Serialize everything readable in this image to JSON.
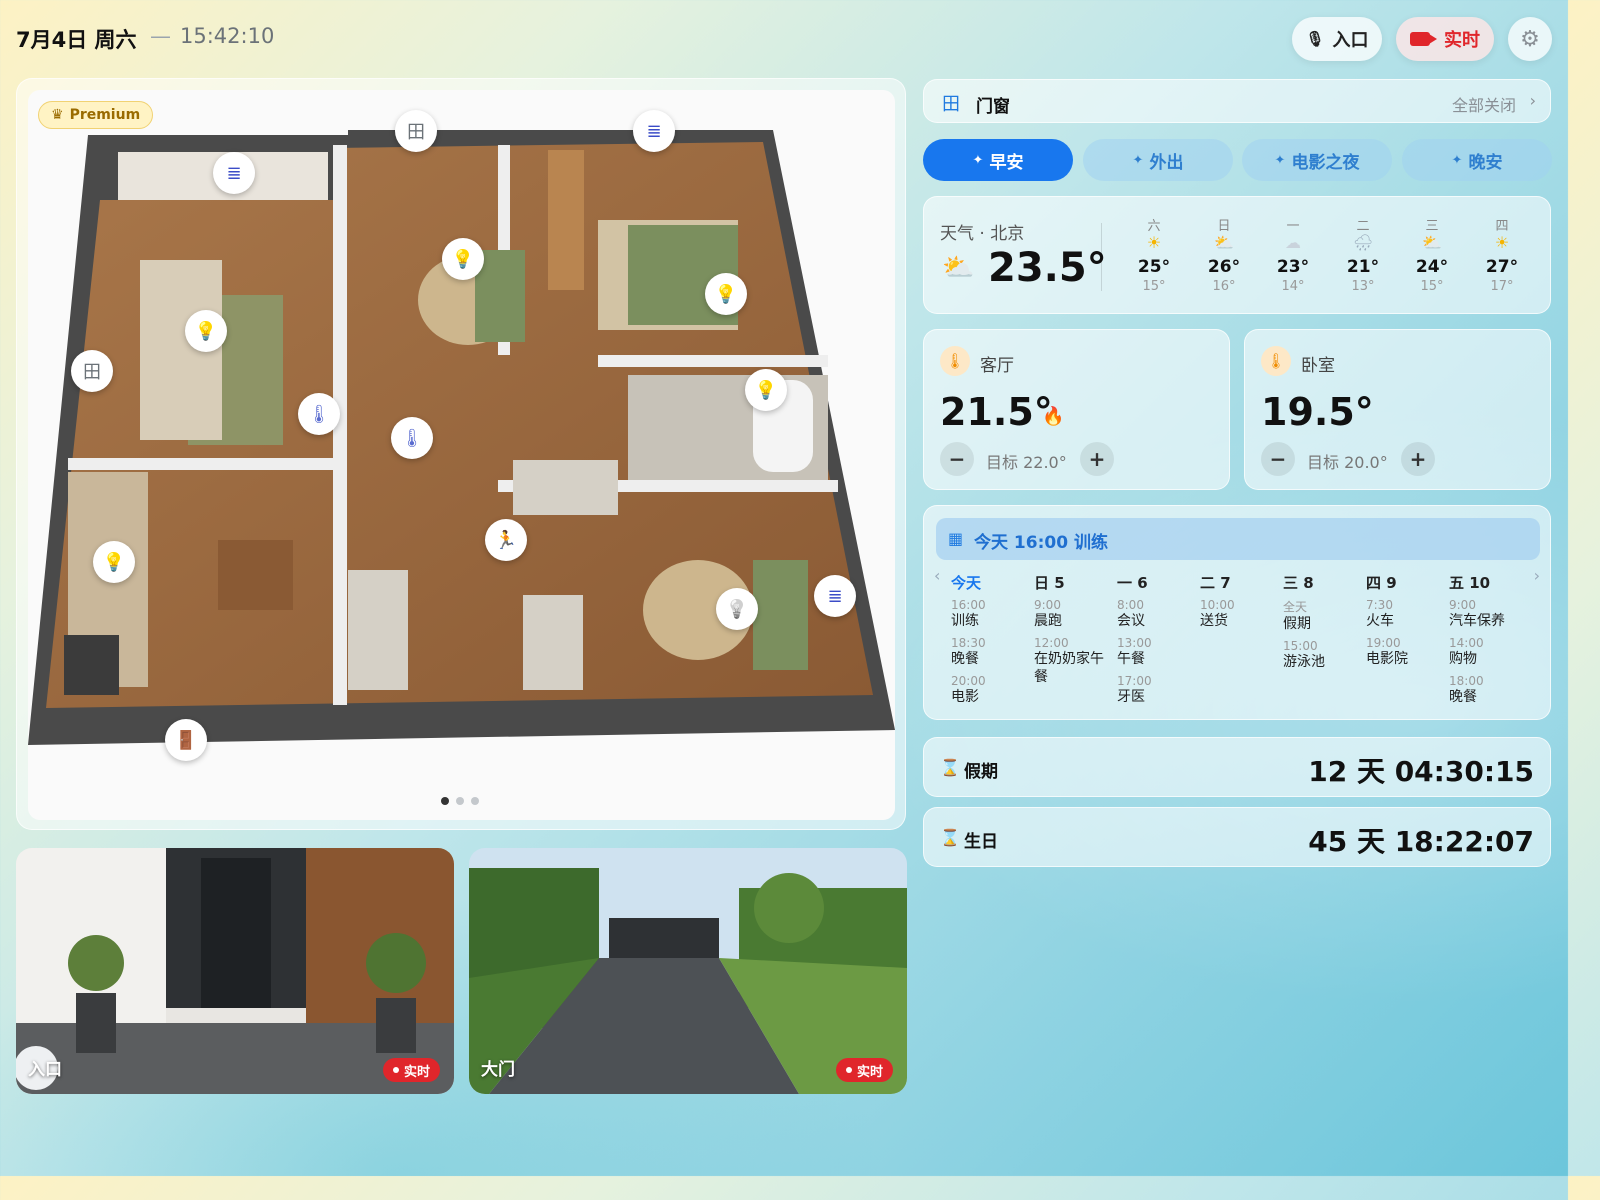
{
  "header": {
    "date": "7月4日 周六",
    "separator": "—",
    "time": "15:42:10",
    "entry_button": "入口",
    "live_button": "实时",
    "colors": {
      "live": "#e0262b"
    }
  },
  "floorplan": {
    "badge": "Premium",
    "markers": [
      {
        "icon": "window-icon",
        "glyph": "田"
      },
      {
        "icon": "blinds-icon",
        "glyph": "≣"
      },
      {
        "icon": "blinds-icon",
        "glyph": "≣"
      },
      {
        "icon": "light-bulb-icon",
        "glyph": "💡"
      },
      {
        "icon": "light-bulb-icon",
        "glyph": "💡"
      },
      {
        "icon": "light-bulb-icon",
        "glyph": "💡"
      },
      {
        "icon": "window-icon",
        "glyph": "田"
      },
      {
        "icon": "thermometer-icon",
        "glyph": "🌡"
      },
      {
        "icon": "thermometer-icon",
        "glyph": "🌡"
      },
      {
        "icon": "light-bulb-icon",
        "glyph": "💡"
      },
      {
        "icon": "motion-sensor-icon",
        "glyph": "🏃"
      },
      {
        "icon": "light-bulb-icon",
        "glyph": "💡"
      },
      {
        "icon": "light-bulb-off-icon",
        "glyph": "💡"
      },
      {
        "icon": "blinds-icon",
        "glyph": "≣"
      },
      {
        "icon": "door-icon",
        "glyph": "🚪"
      }
    ],
    "pages": 3,
    "active_page": 1
  },
  "cameras": [
    {
      "label": "入口",
      "live": "实时"
    },
    {
      "label": "大门",
      "live": "实时"
    }
  ],
  "doors": {
    "title": "门窗",
    "action": "全部关闭"
  },
  "scenes": [
    {
      "label": "早安",
      "active": true
    },
    {
      "label": "外出",
      "active": false
    },
    {
      "label": "电影之夜",
      "active": false
    },
    {
      "label": "晚安",
      "active": false
    }
  ],
  "weather": {
    "title": "天气 · 北京",
    "current": "23.5°",
    "forecast": [
      {
        "day": "六",
        "icon": "sun-icon",
        "glyph": "☀",
        "hi": "25°",
        "lo": "15°"
      },
      {
        "day": "日",
        "icon": "partly-cloudy-icon",
        "glyph": "⛅",
        "hi": "26°",
        "lo": "16°"
      },
      {
        "day": "一",
        "icon": "cloud-icon",
        "glyph": "☁",
        "hi": "23°",
        "lo": "14°"
      },
      {
        "day": "二",
        "icon": "rain-icon",
        "glyph": "🌧",
        "hi": "21°",
        "lo": "13°"
      },
      {
        "day": "三",
        "icon": "partly-cloudy-icon",
        "glyph": "⛅",
        "hi": "24°",
        "lo": "15°"
      },
      {
        "day": "四",
        "icon": "sun-icon",
        "glyph": "☀",
        "hi": "27°",
        "lo": "17°"
      }
    ]
  },
  "rooms": [
    {
      "name": "客厅",
      "temp": "21.5°",
      "target": "目标 22.0°",
      "heating": true
    },
    {
      "name": "卧室",
      "temp": "19.5°",
      "target": "目标 20.0°",
      "heating": false
    }
  ],
  "calendar": {
    "headline": "今天 16:00 训练",
    "days": [
      {
        "label": "今天",
        "today": true,
        "events": [
          {
            "time": "16:00",
            "title": "训练"
          },
          {
            "time": "18:30",
            "title": "晚餐"
          },
          {
            "time": "20:00",
            "title": "电影"
          }
        ]
      },
      {
        "label": "日 5",
        "today": false,
        "events": [
          {
            "time": "9:00",
            "title": "晨跑"
          },
          {
            "time": "12:00",
            "title": "在奶奶家午餐"
          }
        ]
      },
      {
        "label": "一 6",
        "today": false,
        "events": [
          {
            "time": "8:00",
            "title": "会议"
          },
          {
            "time": "13:00",
            "title": "午餐"
          },
          {
            "time": "17:00",
            "title": "牙医"
          }
        ]
      },
      {
        "label": "二 7",
        "today": false,
        "events": [
          {
            "time": "10:00",
            "title": "送货"
          }
        ]
      },
      {
        "label": "三 8",
        "today": false,
        "events": [
          {
            "time": "全天",
            "title": "假期"
          },
          {
            "time": "15:00",
            "title": "游泳池"
          }
        ]
      },
      {
        "label": "四 9",
        "today": false,
        "events": [
          {
            "time": "7:30",
            "title": "火车"
          },
          {
            "time": "19:00",
            "title": "电影院"
          }
        ]
      },
      {
        "label": "五 10",
        "today": false,
        "events": [
          {
            "time": "9:00",
            "title": "汽车保养"
          },
          {
            "time": "14:00",
            "title": "购物"
          },
          {
            "time": "18:00",
            "title": "晚餐"
          }
        ]
      }
    ]
  },
  "countdowns": [
    {
      "label": "假期",
      "value": "12 天 04:30:15"
    },
    {
      "label": "生日",
      "value": "45 天 18:22:07"
    }
  ]
}
